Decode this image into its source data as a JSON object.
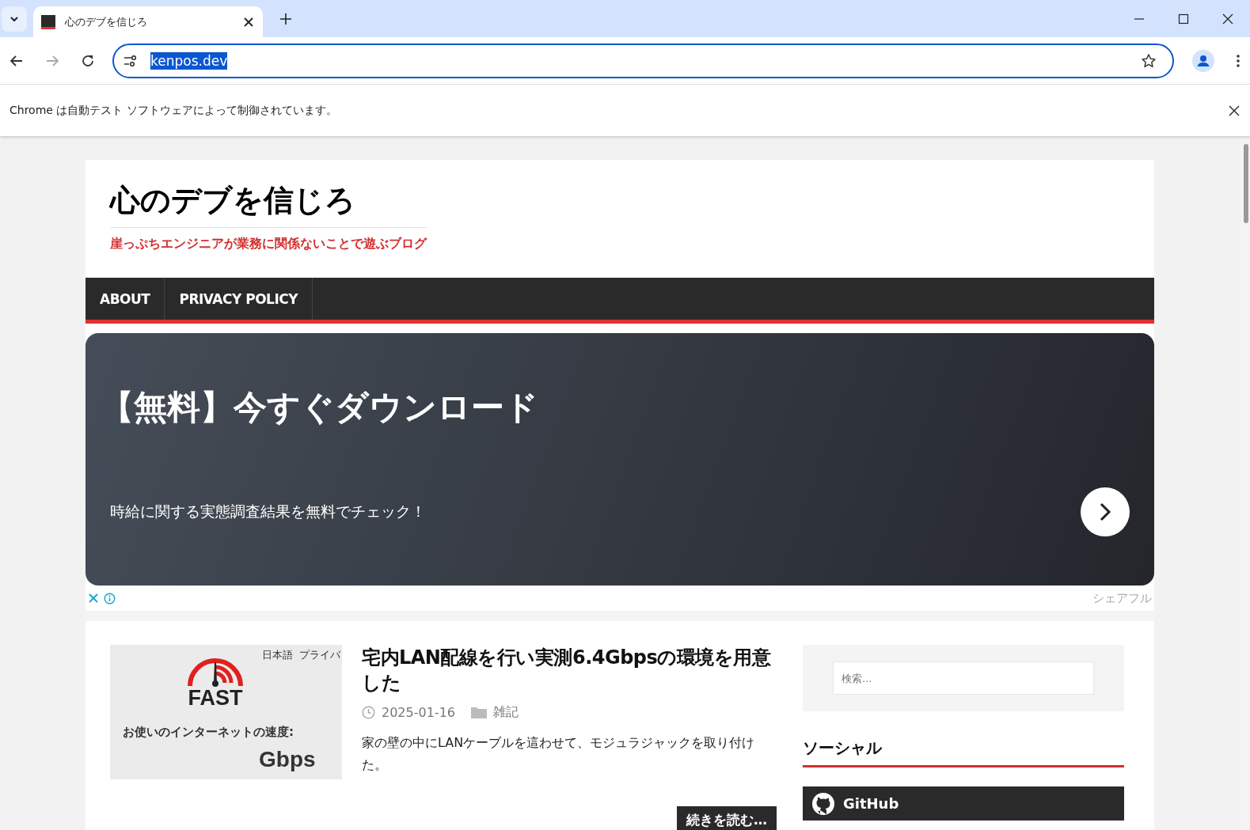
{
  "browser": {
    "tabs": [
      {
        "title": "心のデブを信じろ",
        "selected": true
      }
    ],
    "address": "kenpos.dev",
    "infobar": "Chrome は自動テスト ソフトウェアによって制御されています。"
  },
  "site": {
    "title": "心のデブを信じろ",
    "tagline": "崖っぷちエンジニアが業務に関係ないことで遊ぶブログ"
  },
  "nav": [
    {
      "label": "ABOUT"
    },
    {
      "label": "PRIVACY POLICY"
    }
  ],
  "ad": {
    "headline": "【無料】今すぐダウンロード",
    "text": "時給に関する実態調査結果を無料でチェック！",
    "provider": "シェアフル"
  },
  "posts": [
    {
      "title": "宅内LAN配線を行い実測6.4Gbpsの環境を用意した",
      "date": "2025-01-16",
      "category": "雑記",
      "excerpt": "家の壁の中にLANケーブルを這わせて、モジュラジャックを取り付けた。",
      "more": "続きを読む…",
      "thumbnail": {
        "menu_1": "日本語",
        "menu_2": "プライバ",
        "logo": "FAST",
        "caption": "お使いのインターネットの速度:",
        "unit": "Gbps"
      }
    }
  ],
  "sidebar": {
    "search": {
      "placeholder": "検索..."
    },
    "social_heading": "ソーシャル",
    "social": [
      {
        "label": "GitHub"
      }
    ]
  }
}
